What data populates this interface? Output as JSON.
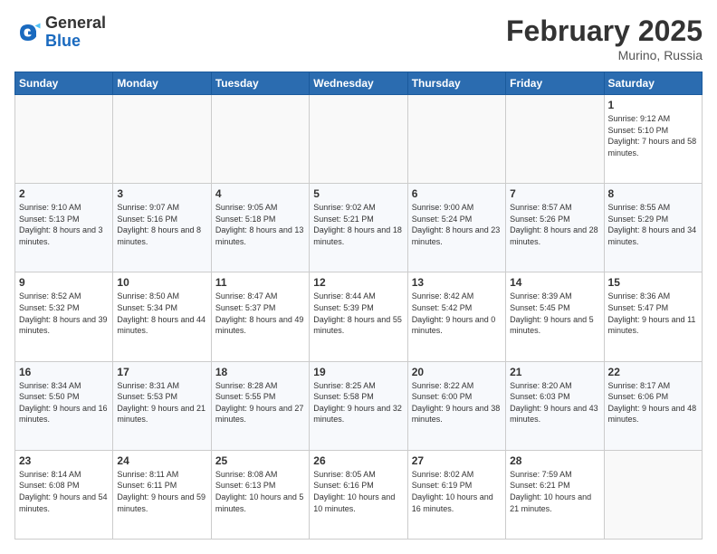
{
  "logo": {
    "general": "General",
    "blue": "Blue"
  },
  "header": {
    "month": "February 2025",
    "location": "Murino, Russia"
  },
  "weekdays": [
    "Sunday",
    "Monday",
    "Tuesday",
    "Wednesday",
    "Thursday",
    "Friday",
    "Saturday"
  ],
  "weeks": [
    [
      {
        "day": "",
        "info": ""
      },
      {
        "day": "",
        "info": ""
      },
      {
        "day": "",
        "info": ""
      },
      {
        "day": "",
        "info": ""
      },
      {
        "day": "",
        "info": ""
      },
      {
        "day": "",
        "info": ""
      },
      {
        "day": "1",
        "info": "Sunrise: 9:12 AM\nSunset: 5:10 PM\nDaylight: 7 hours and 58 minutes."
      }
    ],
    [
      {
        "day": "2",
        "info": "Sunrise: 9:10 AM\nSunset: 5:13 PM\nDaylight: 8 hours and 3 minutes."
      },
      {
        "day": "3",
        "info": "Sunrise: 9:07 AM\nSunset: 5:16 PM\nDaylight: 8 hours and 8 minutes."
      },
      {
        "day": "4",
        "info": "Sunrise: 9:05 AM\nSunset: 5:18 PM\nDaylight: 8 hours and 13 minutes."
      },
      {
        "day": "5",
        "info": "Sunrise: 9:02 AM\nSunset: 5:21 PM\nDaylight: 8 hours and 18 minutes."
      },
      {
        "day": "6",
        "info": "Sunrise: 9:00 AM\nSunset: 5:24 PM\nDaylight: 8 hours and 23 minutes."
      },
      {
        "day": "7",
        "info": "Sunrise: 8:57 AM\nSunset: 5:26 PM\nDaylight: 8 hours and 28 minutes."
      },
      {
        "day": "8",
        "info": "Sunrise: 8:55 AM\nSunset: 5:29 PM\nDaylight: 8 hours and 34 minutes."
      }
    ],
    [
      {
        "day": "9",
        "info": "Sunrise: 8:52 AM\nSunset: 5:32 PM\nDaylight: 8 hours and 39 minutes."
      },
      {
        "day": "10",
        "info": "Sunrise: 8:50 AM\nSunset: 5:34 PM\nDaylight: 8 hours and 44 minutes."
      },
      {
        "day": "11",
        "info": "Sunrise: 8:47 AM\nSunset: 5:37 PM\nDaylight: 8 hours and 49 minutes."
      },
      {
        "day": "12",
        "info": "Sunrise: 8:44 AM\nSunset: 5:39 PM\nDaylight: 8 hours and 55 minutes."
      },
      {
        "day": "13",
        "info": "Sunrise: 8:42 AM\nSunset: 5:42 PM\nDaylight: 9 hours and 0 minutes."
      },
      {
        "day": "14",
        "info": "Sunrise: 8:39 AM\nSunset: 5:45 PM\nDaylight: 9 hours and 5 minutes."
      },
      {
        "day": "15",
        "info": "Sunrise: 8:36 AM\nSunset: 5:47 PM\nDaylight: 9 hours and 11 minutes."
      }
    ],
    [
      {
        "day": "16",
        "info": "Sunrise: 8:34 AM\nSunset: 5:50 PM\nDaylight: 9 hours and 16 minutes."
      },
      {
        "day": "17",
        "info": "Sunrise: 8:31 AM\nSunset: 5:53 PM\nDaylight: 9 hours and 21 minutes."
      },
      {
        "day": "18",
        "info": "Sunrise: 8:28 AM\nSunset: 5:55 PM\nDaylight: 9 hours and 27 minutes."
      },
      {
        "day": "19",
        "info": "Sunrise: 8:25 AM\nSunset: 5:58 PM\nDaylight: 9 hours and 32 minutes."
      },
      {
        "day": "20",
        "info": "Sunrise: 8:22 AM\nSunset: 6:00 PM\nDaylight: 9 hours and 38 minutes."
      },
      {
        "day": "21",
        "info": "Sunrise: 8:20 AM\nSunset: 6:03 PM\nDaylight: 9 hours and 43 minutes."
      },
      {
        "day": "22",
        "info": "Sunrise: 8:17 AM\nSunset: 6:06 PM\nDaylight: 9 hours and 48 minutes."
      }
    ],
    [
      {
        "day": "23",
        "info": "Sunrise: 8:14 AM\nSunset: 6:08 PM\nDaylight: 9 hours and 54 minutes."
      },
      {
        "day": "24",
        "info": "Sunrise: 8:11 AM\nSunset: 6:11 PM\nDaylight: 9 hours and 59 minutes."
      },
      {
        "day": "25",
        "info": "Sunrise: 8:08 AM\nSunset: 6:13 PM\nDaylight: 10 hours and 5 minutes."
      },
      {
        "day": "26",
        "info": "Sunrise: 8:05 AM\nSunset: 6:16 PM\nDaylight: 10 hours and 10 minutes."
      },
      {
        "day": "27",
        "info": "Sunrise: 8:02 AM\nSunset: 6:19 PM\nDaylight: 10 hours and 16 minutes."
      },
      {
        "day": "28",
        "info": "Sunrise: 7:59 AM\nSunset: 6:21 PM\nDaylight: 10 hours and 21 minutes."
      },
      {
        "day": "",
        "info": ""
      }
    ]
  ]
}
